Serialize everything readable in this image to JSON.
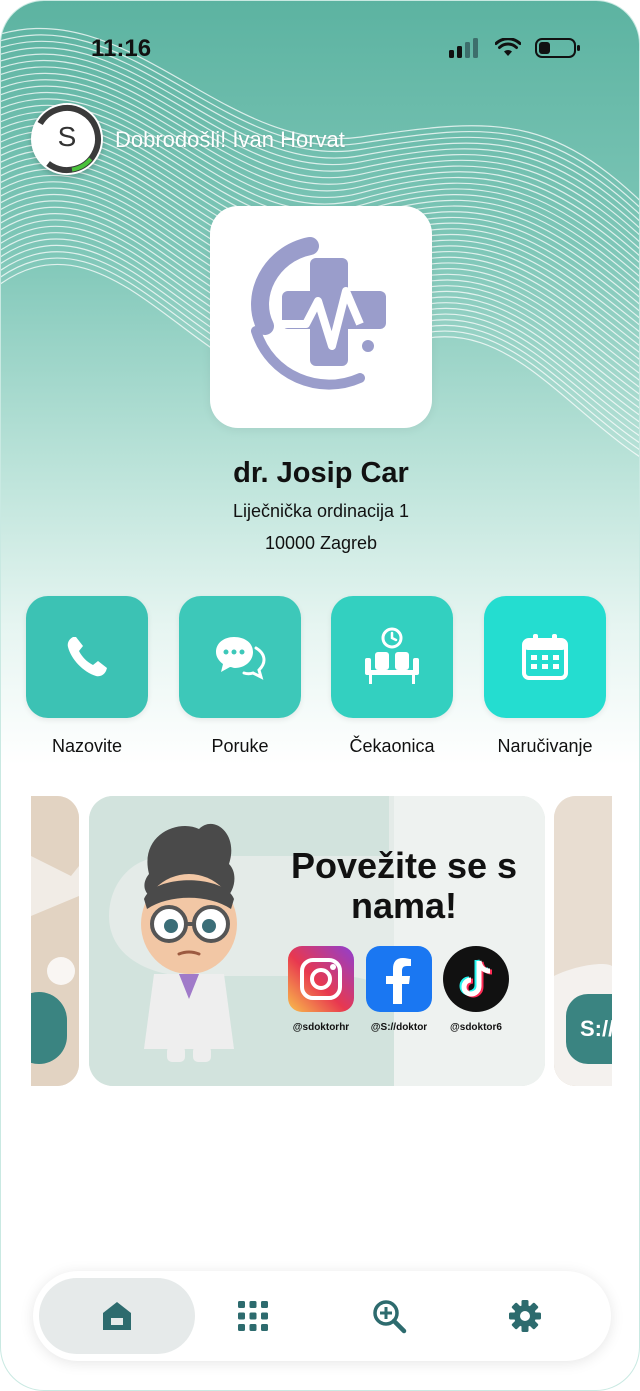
{
  "status_bar": {
    "time": "11:16"
  },
  "header": {
    "greeting": "Dobrodošli! Ivan Horvat",
    "avatar_letter": "S"
  },
  "doctor": {
    "name": "dr. Josip Car",
    "clinic": "Liječnička ordinacija 1",
    "city": "10000 Zagreb"
  },
  "actions": [
    {
      "label": "Nazovite",
      "icon": "phone-icon"
    },
    {
      "label": "Poruke",
      "icon": "chat-icon"
    },
    {
      "label": "Čekaonica",
      "icon": "waiting-room-icon"
    },
    {
      "label": "Naručivanje",
      "icon": "calendar-icon"
    }
  ],
  "carousel": {
    "current": {
      "title": "Povežite se s nama!",
      "handles": [
        "@sdoktorhr",
        "@S://doktor",
        "@sdoktor6"
      ]
    },
    "next_badge": "S://"
  },
  "bottom_nav": [
    {
      "name": "home",
      "icon": "home-icon",
      "active": true
    },
    {
      "name": "menu",
      "icon": "grid-icon",
      "active": false
    },
    {
      "name": "search",
      "icon": "zoom-search-icon",
      "active": false
    },
    {
      "name": "settings",
      "icon": "settings-gear-icon",
      "active": false
    }
  ],
  "colors": {
    "accent": "#2fc7b7",
    "accent_light": "#3fd9c7",
    "nav_icon": "#2d6b6e",
    "logo": "#9a9dcb"
  }
}
